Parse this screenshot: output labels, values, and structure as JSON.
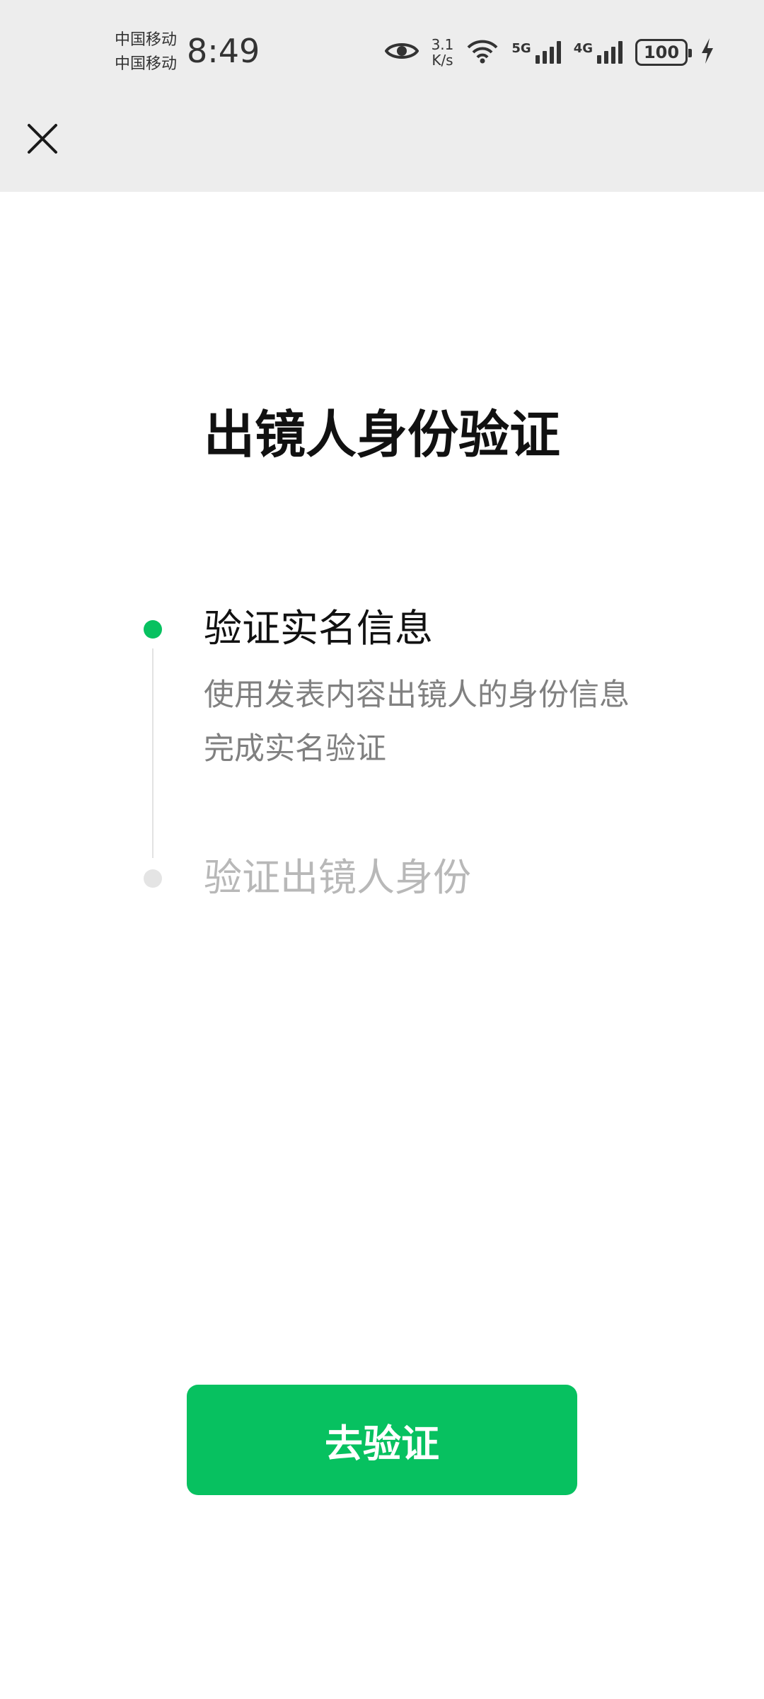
{
  "status_bar": {
    "carrier_1": "中国移动",
    "carrier_2": "中国移动",
    "time": "8:49",
    "net_speed_value": "3.1",
    "net_speed_unit": "K/s",
    "signal_1_label": "5G",
    "signal_2_label": "4G",
    "battery": "100",
    "icons": [
      "eye-icon",
      "wifi-icon",
      "signal-icon",
      "battery-icon",
      "charging-icon"
    ]
  },
  "nav": {
    "close_icon": "close-icon"
  },
  "page": {
    "title": "出镜人身份验证"
  },
  "steps": [
    {
      "title": "验证实名信息",
      "description": "使用发表内容出镜人的身份信息完成实名验证",
      "active": true
    },
    {
      "title": "验证出镜人身份",
      "active": false
    }
  ],
  "actions": {
    "verify_button": "去验证"
  },
  "colors": {
    "accent": "#07c160",
    "header_bg": "#ededed",
    "inactive": "#b8b8b8"
  }
}
